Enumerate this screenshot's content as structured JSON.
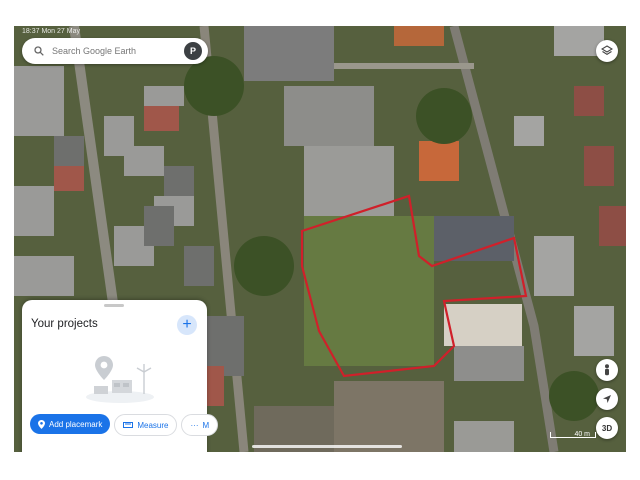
{
  "status": {
    "time_date": "18:37 Mon 27 May",
    "indicators": ""
  },
  "search": {
    "placeholder": "Search Google Earth",
    "avatar_letter": "P"
  },
  "layers_button": {
    "icon": "layers-icon"
  },
  "projects_panel": {
    "title": "Your projects",
    "add_icon": "plus-icon",
    "actions": [
      {
        "label": "Add placemark",
        "icon": "placemark-icon"
      },
      {
        "label": "Measure",
        "icon": "ruler-icon"
      },
      {
        "label": "M",
        "icon": "more-icon"
      }
    ]
  },
  "map_controls": {
    "pegman_icon": "pegman-icon",
    "location_icon": "my-location-icon",
    "view_3d_label": "3D"
  },
  "scale": {
    "label": "40 m"
  },
  "colors": {
    "accent": "#1a73e8",
    "boundary": "#d0202a"
  }
}
